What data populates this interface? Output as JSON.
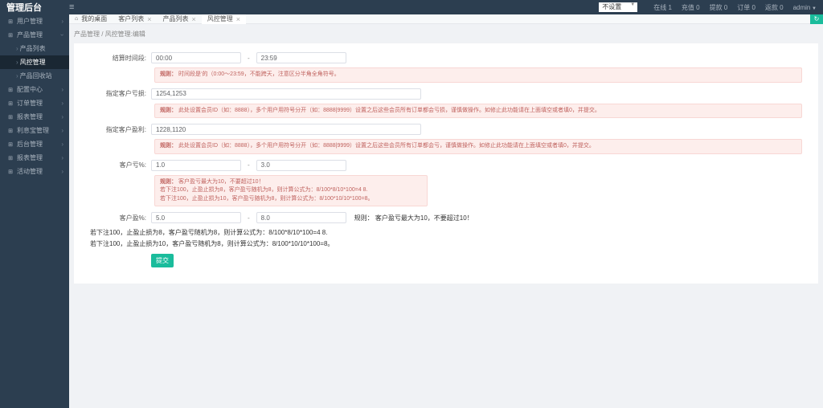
{
  "header": {
    "brand": "管理后台",
    "select_value": "不设置",
    "stats": {
      "online": "在线 1",
      "recharge": "充值 0",
      "withdraw": "提款 0",
      "orders": "订单 0",
      "refund": "返款 0"
    },
    "admin": "admin"
  },
  "sidebar": {
    "items": [
      {
        "icon": "⊞",
        "label": "用户管理",
        "children": []
      },
      {
        "icon": "⊞",
        "label": "产品管理",
        "expanded": true,
        "children": [
          {
            "label": "产品列表"
          },
          {
            "label": "风控管理",
            "active": true
          },
          {
            "label": "产品回收站"
          }
        ]
      },
      {
        "icon": "⊞",
        "label": "配置中心",
        "children": []
      },
      {
        "icon": "⊞",
        "label": "订单管理",
        "children": []
      },
      {
        "icon": "⊞",
        "label": "报表管理",
        "children": []
      },
      {
        "icon": "⊞",
        "label": "利息宝管理",
        "children": []
      },
      {
        "icon": "⊞",
        "label": "后台管理",
        "children": []
      },
      {
        "icon": "⊞",
        "label": "报表管理",
        "children": []
      },
      {
        "icon": "⊞",
        "label": "活动管理",
        "children": []
      }
    ]
  },
  "tabs": [
    {
      "label": "我的桌面",
      "home": true
    },
    {
      "label": "客户列表"
    },
    {
      "label": "产品列表"
    },
    {
      "label": "风控管理",
      "active": true
    }
  ],
  "breadcrumb": "产品管理 / 风控管理:编辑",
  "form": {
    "time_label": "结算时间段:",
    "time_from": "00:00",
    "time_to": "23:59",
    "time_hint_title": "规则：",
    "time_hint": "时间段是‘的（0:00～23:59，不能跨天，注意区分半角全角符号。",
    "loss_label": "指定客户亏损:",
    "loss_value": "1254,1253",
    "loss_hint_title": "规则：",
    "loss_hint": "此处设置会员ID（如：8888），多个用户用符号分开（如：8888|9999）设置之后这些会员所有订单都会亏损，谨慎做操作。如修止此功能请在上面填空或者填0，并提交。",
    "profit_label": "指定客户盈利:",
    "profit_value": "1228,1120",
    "profit_hint_title": "规则：",
    "profit_hint": "此处设置会员ID（如：8888），多个用户用符号分开（如：8888|9999）设置之后这些会员所有订单都会亏，谨慎做操作。如修止此功能请在上面填空或者填0，并提交。",
    "kui_label": "客户亏%:",
    "kui_from": "1.0",
    "kui_to": "3.0",
    "kui_hint_title": "规则：",
    "kui_hint_line1": "客户盈亏最大为10，不要超过10！",
    "kui_hint_line2": "若下注100，止盈止损为8，客户盈亏随机为8，则计算公式为：8/100*8/10*100=4 8.",
    "kui_hint_line3": "若下注100，止盈止损为10，客户盈亏随机为8，则计算公式为：8/100*10/10*100=8。",
    "ying_label": "客户盈%:",
    "ying_from": "5.0",
    "ying_to": "8.0",
    "ying_hint": "规则：    客户盈亏最大为10，不要超过10！",
    "rules_line1": "若下注100，止盈止损为8，客户盈亏随机为8，则计算公式为：8/100*8/10*100=4 8.",
    "rules_line2": "若下注100，止盈止损为10，客户盈亏随机为8，则计算公式为：8/100*10/10*100=8。",
    "submit": "提交"
  }
}
